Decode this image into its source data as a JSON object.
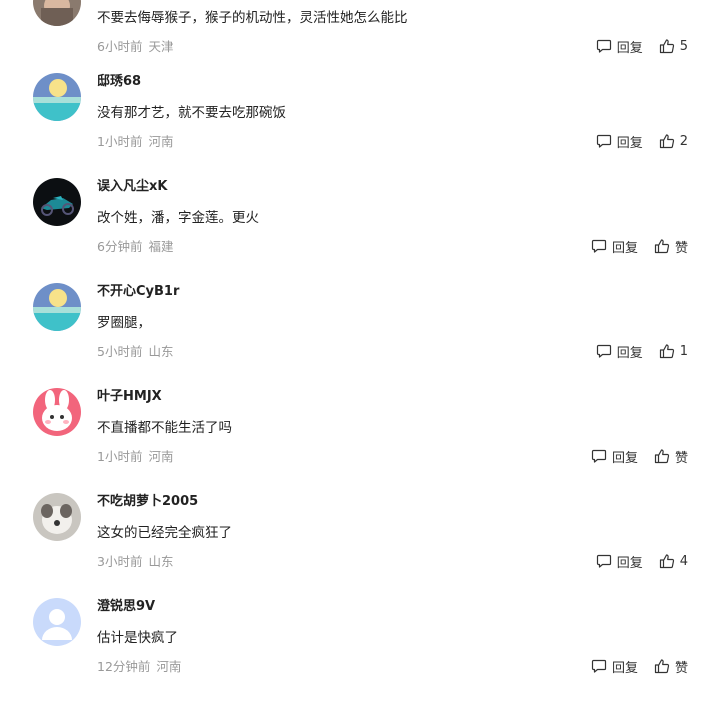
{
  "labels": {
    "reply": "回复"
  },
  "comments": [
    {
      "avatar": "avatar-face",
      "username": "",
      "text": "不要去侮辱猴子，猴子的机动性，灵活性她怎么能比",
      "time": "6小时前",
      "location": "天津",
      "like": "5"
    },
    {
      "avatar": "avatar-beach-sun",
      "username": "邸琇68",
      "text": "没有那才艺，就不要去吃那碗饭",
      "time": "1小时前",
      "location": "河南",
      "like": "2"
    },
    {
      "avatar": "avatar-motorcycle",
      "username": "误入凡尘xK",
      "text": "改个姓，潘，字金莲。更火",
      "time": "6分钟前",
      "location": "福建",
      "like": "赞"
    },
    {
      "avatar": "avatar-beach-sun",
      "username": "不开心CyB1r",
      "text": "罗圈腿，",
      "time": "5小时前",
      "location": "山东",
      "like": "1"
    },
    {
      "avatar": "avatar-pink-rabbit",
      "username": "叶子HMJX",
      "text": "不直播都不能生活了吗",
      "time": "1小时前",
      "location": "河南",
      "like": "赞"
    },
    {
      "avatar": "avatar-dog-photo",
      "username": "不吃胡萝卜2005",
      "text": "这女的已经完全疯狂了",
      "time": "3小时前",
      "location": "山东",
      "like": "4"
    },
    {
      "avatar": "avatar-default-user",
      "username": "澄锐思9V",
      "text": "估计是快疯了",
      "time": "12分钟前",
      "location": "河南",
      "like": "赞"
    }
  ]
}
